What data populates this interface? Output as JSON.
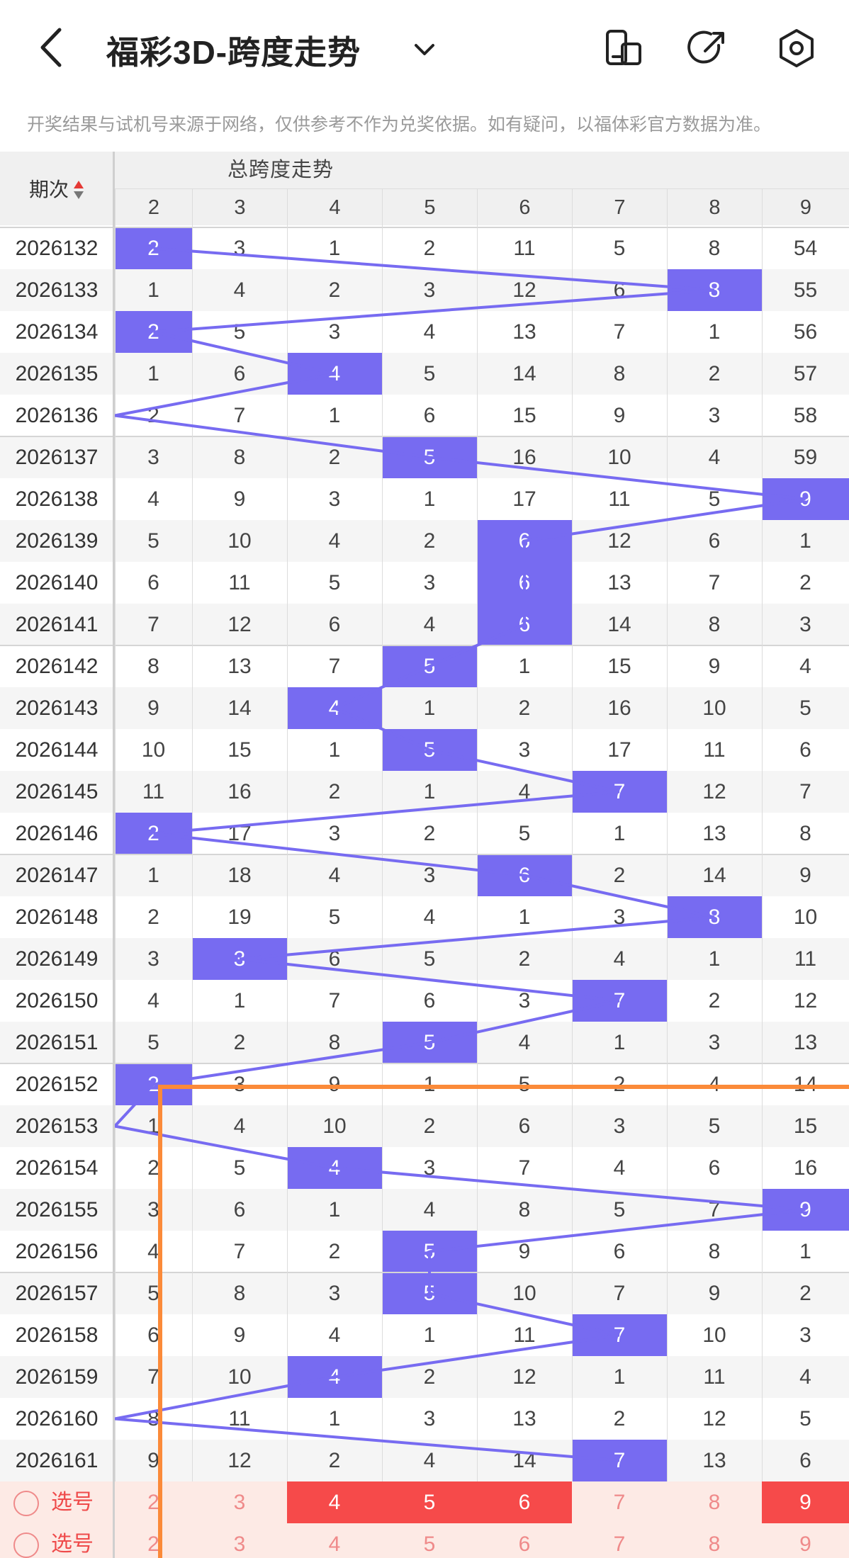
{
  "header": {
    "title": "福彩3D-跨度走势",
    "back_icon": "chevron-left-icon",
    "icons": [
      "phone-icon",
      "share-icon",
      "settings-hexagon-icon"
    ]
  },
  "notice": "开奖结果与试机号来源于网络，仅供参考不作为兑奖依据。如有疑问，以福体彩官方数据为准。",
  "table": {
    "period_header": "期次",
    "group_header": "总跨度走势",
    "columns": [
      "2",
      "3",
      "4",
      "5",
      "6",
      "7",
      "8",
      "9"
    ],
    "hit_color": "#776bf1",
    "rows": [
      {
        "period": "2026132",
        "cells": [
          "2",
          "3",
          "1",
          "2",
          "11",
          "5",
          "8",
          "54"
        ],
        "hit": 0
      },
      {
        "period": "2026133",
        "cells": [
          "1",
          "4",
          "2",
          "3",
          "12",
          "6",
          "8",
          "55"
        ],
        "hit": 6
      },
      {
        "period": "2026134",
        "cells": [
          "2",
          "5",
          "3",
          "4",
          "13",
          "7",
          "1",
          "56"
        ],
        "hit": 0
      },
      {
        "period": "2026135",
        "cells": [
          "1",
          "6",
          "4",
          "5",
          "14",
          "8",
          "2",
          "57"
        ],
        "hit": 2
      },
      {
        "period": "2026136",
        "cells": [
          "2",
          "7",
          "1",
          "6",
          "15",
          "9",
          "3",
          "58"
        ],
        "hit": -1
      },
      {
        "period": "2026137",
        "cells": [
          "3",
          "8",
          "2",
          "5",
          "16",
          "10",
          "4",
          "59"
        ],
        "hit": 3
      },
      {
        "period": "2026138",
        "cells": [
          "4",
          "9",
          "3",
          "1",
          "17",
          "11",
          "5",
          "9"
        ],
        "hit": 7
      },
      {
        "period": "2026139",
        "cells": [
          "5",
          "10",
          "4",
          "2",
          "6",
          "12",
          "6",
          "1"
        ],
        "hit": 4
      },
      {
        "period": "2026140",
        "cells": [
          "6",
          "11",
          "5",
          "3",
          "6",
          "13",
          "7",
          "2"
        ],
        "hit": 4
      },
      {
        "period": "2026141",
        "cells": [
          "7",
          "12",
          "6",
          "4",
          "6",
          "14",
          "8",
          "3"
        ],
        "hit": 4
      },
      {
        "period": "2026142",
        "cells": [
          "8",
          "13",
          "7",
          "5",
          "1",
          "15",
          "9",
          "4"
        ],
        "hit": 3
      },
      {
        "period": "2026143",
        "cells": [
          "9",
          "14",
          "4",
          "1",
          "2",
          "16",
          "10",
          "5"
        ],
        "hit": 2
      },
      {
        "period": "2026144",
        "cells": [
          "10",
          "15",
          "1",
          "5",
          "3",
          "17",
          "11",
          "6"
        ],
        "hit": 3
      },
      {
        "period": "2026145",
        "cells": [
          "11",
          "16",
          "2",
          "1",
          "4",
          "7",
          "12",
          "7"
        ],
        "hit": 5
      },
      {
        "period": "2026146",
        "cells": [
          "2",
          "17",
          "3",
          "2",
          "5",
          "1",
          "13",
          "8"
        ],
        "hit": 0
      },
      {
        "period": "2026147",
        "cells": [
          "1",
          "18",
          "4",
          "3",
          "6",
          "2",
          "14",
          "9"
        ],
        "hit": 4
      },
      {
        "period": "2026148",
        "cells": [
          "2",
          "19",
          "5",
          "4",
          "1",
          "3",
          "8",
          "10"
        ],
        "hit": 6
      },
      {
        "period": "2026149",
        "cells": [
          "3",
          "3",
          "6",
          "5",
          "2",
          "4",
          "1",
          "11"
        ],
        "hit": 1
      },
      {
        "period": "2026150",
        "cells": [
          "4",
          "1",
          "7",
          "6",
          "3",
          "7",
          "2",
          "12"
        ],
        "hit": 5
      },
      {
        "period": "2026151",
        "cells": [
          "5",
          "2",
          "8",
          "5",
          "4",
          "1",
          "3",
          "13"
        ],
        "hit": 3
      },
      {
        "period": "2026152",
        "cells": [
          "2",
          "3",
          "9",
          "1",
          "5",
          "2",
          "4",
          "14"
        ],
        "hit": 0
      },
      {
        "period": "2026153",
        "cells": [
          "1",
          "4",
          "10",
          "2",
          "6",
          "3",
          "5",
          "15"
        ],
        "hit": -1
      },
      {
        "period": "2026154",
        "cells": [
          "2",
          "5",
          "4",
          "3",
          "7",
          "4",
          "6",
          "16"
        ],
        "hit": 2
      },
      {
        "period": "2026155",
        "cells": [
          "3",
          "6",
          "1",
          "4",
          "8",
          "5",
          "7",
          "9"
        ],
        "hit": 7
      },
      {
        "period": "2026156",
        "cells": [
          "4",
          "7",
          "2",
          "5",
          "9",
          "6",
          "8",
          "1"
        ],
        "hit": 3
      },
      {
        "period": "2026157",
        "cells": [
          "5",
          "8",
          "3",
          "5",
          "10",
          "7",
          "9",
          "2"
        ],
        "hit": 3
      },
      {
        "period": "2026158",
        "cells": [
          "6",
          "9",
          "4",
          "1",
          "11",
          "7",
          "10",
          "3"
        ],
        "hit": 5
      },
      {
        "period": "2026159",
        "cells": [
          "7",
          "10",
          "4",
          "2",
          "12",
          "1",
          "11",
          "4"
        ],
        "hit": 2
      },
      {
        "period": "2026160",
        "cells": [
          "8",
          "11",
          "1",
          "3",
          "13",
          "2",
          "12",
          "5"
        ],
        "hit": -1
      },
      {
        "period": "2026161",
        "cells": [
          "9",
          "12",
          "2",
          "4",
          "14",
          "7",
          "13",
          "6"
        ],
        "hit": 5
      }
    ]
  },
  "selector": {
    "rows": [
      {
        "label": "选号",
        "options": [
          "2",
          "3",
          "4",
          "5",
          "6",
          "7",
          "8",
          "9"
        ],
        "selected": [
          2,
          3,
          4,
          7
        ]
      },
      {
        "label": "选号",
        "options": [
          "2",
          "3",
          "4",
          "5",
          "6",
          "7",
          "8",
          "9"
        ],
        "selected": []
      }
    ],
    "selected_color": "#f64a4a"
  }
}
